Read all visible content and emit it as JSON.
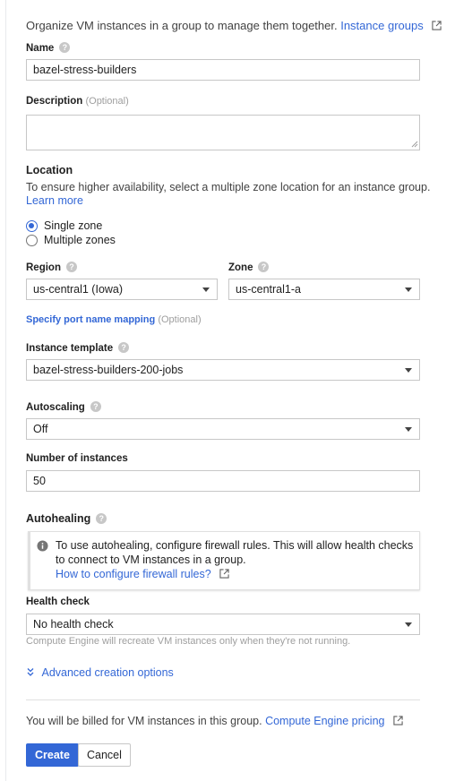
{
  "intro": {
    "text": "Organize VM instances in a group to manage them together.",
    "link": "Instance groups"
  },
  "name": {
    "label": "Name",
    "value": "bazel-stress-builders"
  },
  "description": {
    "label": "Description",
    "optional": "(Optional)",
    "value": ""
  },
  "location": {
    "label": "Location",
    "text": "To ensure higher availability, select a multiple zone location for an instance group.",
    "learn_more": "Learn more",
    "options": [
      "Single zone",
      "Multiple zones"
    ],
    "selected": "Single zone"
  },
  "region": {
    "label": "Region",
    "value": "us-central1 (Iowa)"
  },
  "zone": {
    "label": "Zone",
    "value": "us-central1-a"
  },
  "port_mapping": {
    "link": "Specify port name mapping",
    "optional": "(Optional)"
  },
  "instance_template": {
    "label": "Instance template",
    "value": "bazel-stress-builders-200-jobs"
  },
  "autoscaling": {
    "label": "Autoscaling",
    "value": "Off"
  },
  "num_instances": {
    "label": "Number of instances",
    "value": "50"
  },
  "autohealing": {
    "label": "Autohealing",
    "info_line1": "To use autohealing, configure firewall rules. This will allow health checks",
    "info_line2": "to connect to VM instances in a group.",
    "info_link": "How to configure firewall rules?"
  },
  "health_check": {
    "label": "Health check",
    "value": "No health check",
    "hint": "Compute Engine will recreate VM instances only when they're not running."
  },
  "advanced": {
    "label": "Advanced creation options"
  },
  "billing": {
    "text": "You will be billed for VM instances in this group.",
    "link": "Compute Engine pricing"
  },
  "buttons": {
    "create": "Create",
    "cancel": "Cancel"
  },
  "colors": {
    "accent": "#3367d6",
    "text": "#212121",
    "muted": "#9e9e9e",
    "border": "#c7c7c7"
  }
}
